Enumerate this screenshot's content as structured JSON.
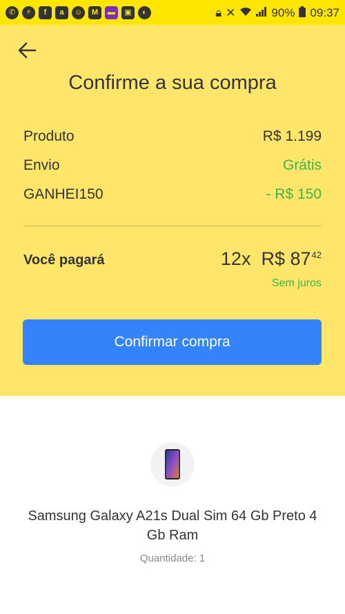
{
  "status_bar": {
    "notification_icons": [
      "whatsapp-icon",
      "messenger-icon",
      "facebook-icon",
      "amazon-icon",
      "android-icon",
      "gmail-icon",
      "app-icon",
      "photo-icon",
      "bag-icon"
    ],
    "battery": "90%",
    "time": "09:37"
  },
  "header": {
    "title": "Confirme a sua compra"
  },
  "summary": {
    "product_label": "Produto",
    "product_value": "R$ 1.199",
    "shipping_label": "Envio",
    "shipping_value": "Grátis",
    "coupon_label": "GANHEI150",
    "coupon_value": "- R$ 150"
  },
  "payment": {
    "label": "Você pagará",
    "installments": "12x",
    "amount": "R$ 87",
    "cents": "42",
    "interest_note": "Sem juros"
  },
  "confirm_button": {
    "label": "Confirmar compra"
  },
  "product": {
    "name": "Samsung Galaxy A21s Dual Sim 64 Gb Preto 4 Gb Ram",
    "quantity": "Quantidade: 1"
  },
  "colors": {
    "status_bar_bg": "#fee600",
    "panel_bg": "#ffe66b",
    "button_bg": "#3483fa",
    "green": "#39b54a"
  }
}
